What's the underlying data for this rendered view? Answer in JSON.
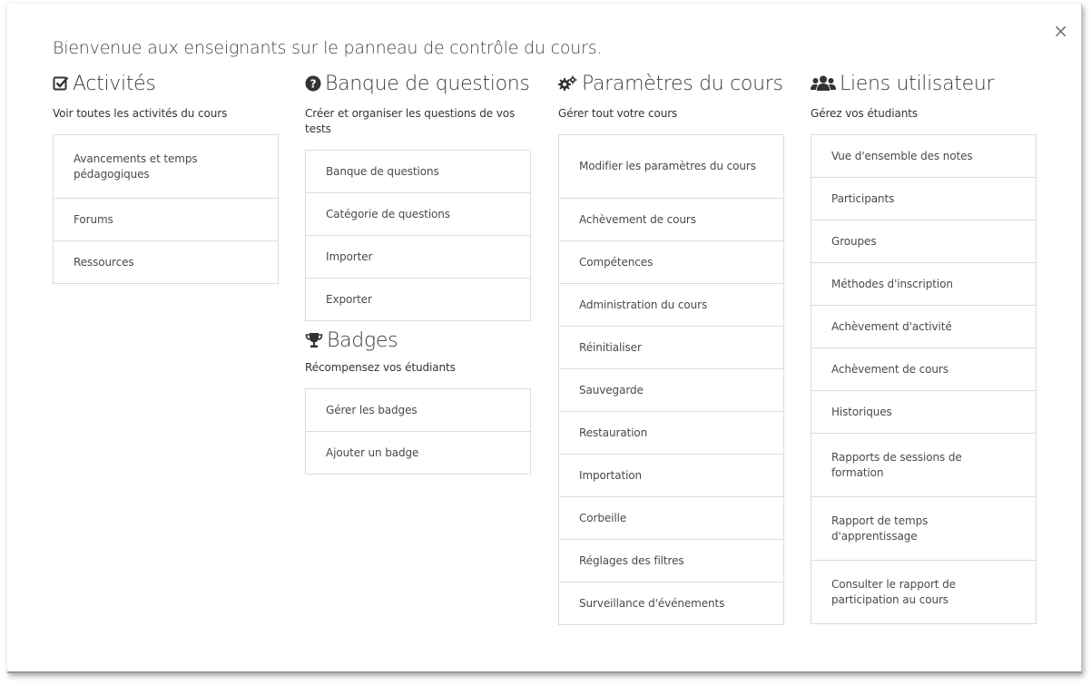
{
  "close_label": "×",
  "welcome": "Bienvenue aux enseignants sur le panneau de contrôle du cours.",
  "columns": {
    "activites": {
      "icon": "check-square-icon",
      "title": "Activités",
      "desc": "Voir toutes les activités du cours",
      "items": [
        "Avancements et temps pédagogiques",
        "Forums",
        "Ressources"
      ]
    },
    "banque": {
      "icon": "question-circle-icon",
      "title": "Banque de questions",
      "desc": "Créer et organiser les questions de vos tests",
      "items": [
        "Banque de questions",
        "Catégorie de questions",
        "Importer",
        "Exporter"
      ]
    },
    "badges": {
      "icon": "trophy-icon",
      "title": "Badges",
      "desc": "Récompensez vos étudiants",
      "items": [
        "Gérer les badges",
        "Ajouter un badge"
      ]
    },
    "parametres": {
      "icon": "gears-icon",
      "title": "Paramètres du cours",
      "desc": "Gérer tout votre cours",
      "items": [
        "Modifier les paramètres du cours",
        "Achèvement de cours",
        "Compétences",
        "Administration du cours",
        "Réinitialiser",
        "Sauvegarde",
        "Restauration",
        "Importation",
        "Corbeille",
        "Réglages des filtres",
        "Surveillance d'événements"
      ]
    },
    "liens": {
      "icon": "users-icon",
      "title": "Liens utilisateur",
      "desc": "Gérez vos étudiants",
      "items": [
        "Vue d'ensemble des notes",
        "Participants",
        "Groupes",
        "Méthodes d'inscription",
        "Achèvement d'activité",
        "Achèvement de cours",
        "Historiques",
        "Rapports de sessions de formation",
        "Rapport de temps d'apprentissage",
        "Consulter le rapport de participation au cours"
      ]
    }
  }
}
